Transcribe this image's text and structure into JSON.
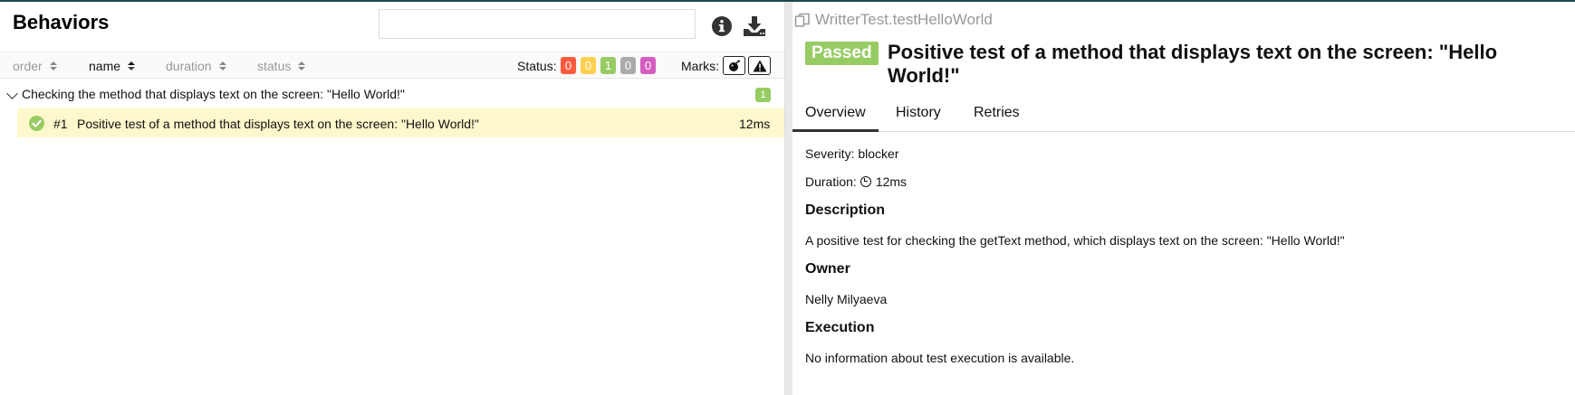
{
  "left": {
    "title": "Behaviors",
    "search": {
      "value": "",
      "placeholder": ""
    },
    "icons": [
      "info-icon",
      "download-icon"
    ],
    "sort_columns": [
      {
        "label": "order",
        "active": false
      },
      {
        "label": "name",
        "active": true
      },
      {
        "label": "duration",
        "active": false
      },
      {
        "label": "status",
        "active": false
      }
    ],
    "status_label": "Status:",
    "status_badges": [
      {
        "status": "failed",
        "count": "0",
        "color": "#fd5a3e"
      },
      {
        "status": "broken",
        "count": "0",
        "color": "#ffd050"
      },
      {
        "status": "passed",
        "count": "1",
        "color": "#97cc64"
      },
      {
        "status": "skipped",
        "count": "0",
        "color": "#aaaaaa"
      },
      {
        "status": "unknown",
        "count": "0",
        "color": "#d35ebe"
      }
    ],
    "marks_label": "Marks:",
    "marks": [
      "bomb-icon",
      "warning-icon"
    ],
    "group": {
      "title": "Checking the method that displays text on the screen: \"Hello World!\"",
      "count": "1"
    },
    "test": {
      "number": "#1",
      "name": "Positive test of a method that displays text on the screen: \"Hello World!\"",
      "duration": "12ms",
      "status_color": "#97cc64"
    }
  },
  "right": {
    "breadcrumb": "WritterTest.testHelloWorld",
    "status": "Passed",
    "title": "Positive test of a method that displays text on the screen: \"Hello World!\"",
    "tabs": [
      {
        "label": "Overview",
        "active": true
      },
      {
        "label": "History",
        "active": false
      },
      {
        "label": "Retries",
        "active": false
      }
    ],
    "severity": "Severity: blocker",
    "duration_label": "Duration:",
    "duration_value": "12ms",
    "description_heading": "Description",
    "description": "A positive test for checking the getText method, which displays text on the screen: \"Hello World!\"",
    "owner_heading": "Owner",
    "owner": "Nelly Milyaeva",
    "execution_heading": "Execution",
    "execution": "No information about test execution is available."
  },
  "colors": {
    "accent": "#1d4a50",
    "passed": "#97cc64",
    "selected_row": "#fff8cc"
  }
}
